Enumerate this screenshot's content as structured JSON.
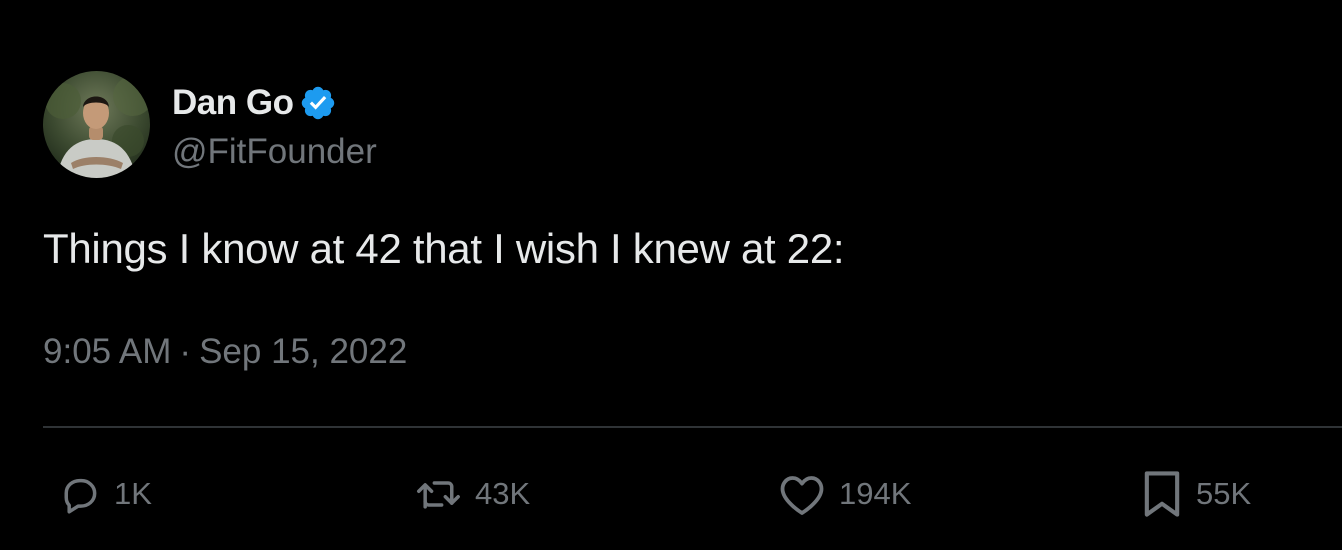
{
  "author": {
    "display_name": "Dan Go",
    "handle": "@FitFounder",
    "verified_icon": "verified-badge-icon",
    "verified_color": "#1d9bf0"
  },
  "tweet": {
    "text": "Things I know at 42 that I wish I knew at 22:",
    "time": "9:05 AM",
    "separator": "·",
    "date": "Sep 15, 2022"
  },
  "actions": {
    "reply": {
      "icon": "reply-icon",
      "count": "1K"
    },
    "retweet": {
      "icon": "retweet-icon",
      "count": "43K"
    },
    "like": {
      "icon": "heart-icon",
      "count": "194K"
    },
    "bookmark": {
      "icon": "bookmark-icon",
      "count": "55K"
    }
  },
  "colors": {
    "background": "#000000",
    "primary_text": "#e7e9ea",
    "secondary_text": "#71767b",
    "divider": "#2f3336"
  }
}
